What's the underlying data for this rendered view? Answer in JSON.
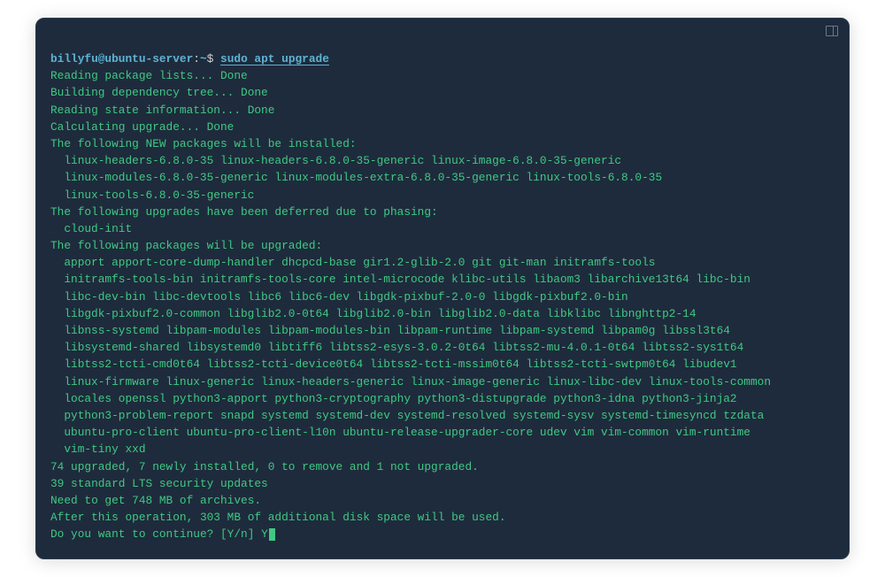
{
  "prompt": {
    "user": "billyfu@ubuntu-server",
    "path": "~",
    "symbol": "$",
    "command": "sudo apt upgrade"
  },
  "output": {
    "reading_packages": "Reading package lists... Done",
    "building_tree": "Building dependency tree... Done",
    "reading_state": "Reading state information... Done",
    "calculating": "Calculating upgrade... Done",
    "new_packages_header": "The following NEW packages will be installed:",
    "new_packages": [
      "linux-headers-6.8.0-35 linux-headers-6.8.0-35-generic linux-image-6.8.0-35-generic",
      "linux-modules-6.8.0-35-generic linux-modules-extra-6.8.0-35-generic linux-tools-6.8.0-35",
      "linux-tools-6.8.0-35-generic"
    ],
    "deferred_header": "The following upgrades have been deferred due to phasing:",
    "deferred": [
      "cloud-init"
    ],
    "upgraded_header": "The following packages will be upgraded:",
    "upgraded": [
      "apport apport-core-dump-handler dhcpcd-base gir1.2-glib-2.0 git git-man initramfs-tools",
      "initramfs-tools-bin initramfs-tools-core intel-microcode klibc-utils libaom3 libarchive13t64 libc-bin",
      "libc-dev-bin libc-devtools libc6 libc6-dev libgdk-pixbuf-2.0-0 libgdk-pixbuf2.0-bin",
      "libgdk-pixbuf2.0-common libglib2.0-0t64 libglib2.0-bin libglib2.0-data libklibc libnghttp2-14",
      "libnss-systemd libpam-modules libpam-modules-bin libpam-runtime libpam-systemd libpam0g libssl3t64",
      "libsystemd-shared libsystemd0 libtiff6 libtss2-esys-3.0.2-0t64 libtss2-mu-4.0.1-0t64 libtss2-sys1t64",
      "libtss2-tcti-cmd0t64 libtss2-tcti-device0t64 libtss2-tcti-mssim0t64 libtss2-tcti-swtpm0t64 libudev1",
      "linux-firmware linux-generic linux-headers-generic linux-image-generic linux-libc-dev linux-tools-common",
      "locales openssl python3-apport python3-cryptography python3-distupgrade python3-idna python3-jinja2",
      "python3-problem-report snapd systemd systemd-dev systemd-resolved systemd-sysv systemd-timesyncd tzdata",
      "ubuntu-pro-client ubuntu-pro-client-l10n ubuntu-release-upgrader-core udev vim vim-common vim-runtime",
      "vim-tiny xxd"
    ],
    "summary1": "74 upgraded, 7 newly installed, 0 to remove and 1 not upgraded.",
    "summary2": "39 standard LTS security updates",
    "summary3": "Need to get 748 MB of archives.",
    "summary4": "After this operation, 303 MB of additional disk space will be used.",
    "prompt_question": "Do you want to continue? [Y/n] ",
    "user_input": "Y"
  }
}
